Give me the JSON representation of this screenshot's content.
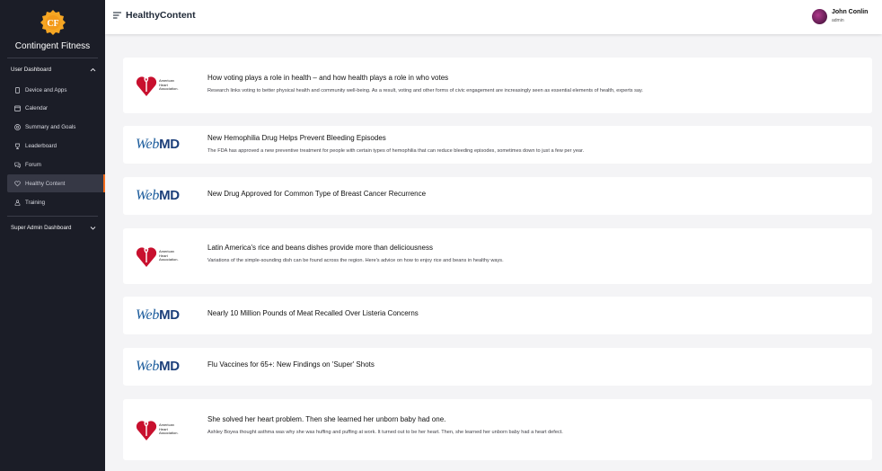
{
  "sidebar": {
    "brand": "Contingent Fitness",
    "user_dashboard_label": "User Dashboard",
    "items": [
      {
        "label": "Device and Apps",
        "icon": "device-icon"
      },
      {
        "label": "Calendar",
        "icon": "calendar-icon"
      },
      {
        "label": "Summary and Goals",
        "icon": "target-icon"
      },
      {
        "label": "Leaderboard",
        "icon": "trophy-icon"
      },
      {
        "label": "Forum",
        "icon": "forum-icon"
      },
      {
        "label": "Healthy Content",
        "icon": "heart-icon",
        "active": true
      },
      {
        "label": "Training",
        "icon": "training-icon"
      }
    ],
    "super_admin_label": "Super Admin Dashboard",
    "active_accent": "#f26a1b"
  },
  "header": {
    "title": "HealthyContent",
    "user_name": "John Conlin",
    "user_role": "admin"
  },
  "aha_logo_text": [
    "American",
    "Heart",
    "Association."
  ],
  "webmd_logo": {
    "italic": "Web",
    "bold": "MD"
  },
  "articles": [
    {
      "source": "aha",
      "title": "How voting plays a role in health – and how health plays a role in who votes",
      "description": "Research links voting to better physical health and community well-being. As a result, voting and other forms of civic engagement are increasingly seen as essential elements of health, experts say."
    },
    {
      "source": "webmd",
      "title": "New Hemophilia Drug Helps Prevent Bleeding Episodes",
      "description": "The FDA has approved a new preventive treatment for people with certain types of hemophilia that can reduce bleeding episodes, sometimes down to just a few per year."
    },
    {
      "source": "webmd",
      "title": "New Drug Approved for Common Type of Breast Cancer Recurrence",
      "description": ""
    },
    {
      "source": "aha",
      "title": "Latin America's rice and beans dishes provide more than deliciousness",
      "description": "Variations of the simple-sounding dish can be found across the region. Here's advice on how to enjoy rice and beans in healthy ways."
    },
    {
      "source": "webmd",
      "title": "Nearly 10 Million Pounds of Meat Recalled Over Listeria Concerns",
      "description": ""
    },
    {
      "source": "webmd",
      "title": "Flu Vaccines for 65+: New Findings on 'Super' Shots",
      "description": ""
    },
    {
      "source": "aha",
      "title": "She solved her heart problem. Then she learned her unborn baby had one.",
      "description": "Ashley Boyea thought asthma was why she was huffing and puffing at work. It turned out to be her heart. Then, she learned her unborn baby had a heart defect."
    }
  ]
}
